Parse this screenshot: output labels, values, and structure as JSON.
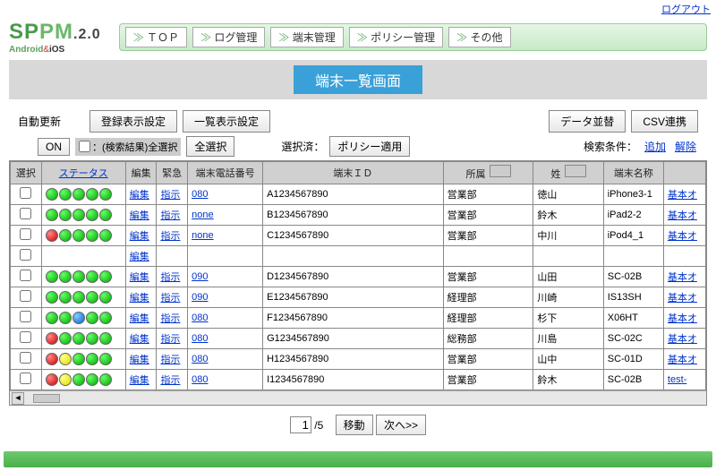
{
  "links": {
    "logout": "ログアウト"
  },
  "logo": {
    "brand": "SPPM",
    "version": ".2.0",
    "sub_android": "Android",
    "sub_amp": "&",
    "sub_ios": "iOS"
  },
  "nav": [
    "ＴＯＰ",
    "ログ管理",
    "端末管理",
    "ポリシー管理",
    "その他"
  ],
  "page_title": "端末一覧画面",
  "toolbar": {
    "auto_refresh_label": "自動更新",
    "on_btn": "ON",
    "reg_display_btn": "登録表示設定",
    "list_display_btn": "一覧表示設定",
    "data_sort_btn": "データ並替",
    "csv_btn": "CSV連携",
    "search_all_chk": "：(検索結果)全選択",
    "select_all_btn": "全選択",
    "selected_label": "選択済：",
    "policy_apply_btn": "ポリシー適用",
    "cond_label": "検索条件：",
    "cond_add": "追加",
    "cond_remove": "解除"
  },
  "headers": {
    "select": "選択",
    "status": "ステータス",
    "edit": "編集",
    "urgent": "緊急",
    "phone": "端末電話番号",
    "id": "端末ＩＤ",
    "dept": "所属",
    "name": "姓",
    "device": "端末名称",
    "basic": ""
  },
  "rows": [
    {
      "status": [
        "g",
        "g",
        "g",
        "g",
        "g"
      ],
      "edit": "編集",
      "urgent": "指示",
      "phone": "080",
      "id": "A1234567890",
      "dept": "営業部",
      "name": "徳山",
      "device": "iPhone3-1",
      "basic": "基本オ"
    },
    {
      "status": [
        "g",
        "g",
        "g",
        "g",
        "g"
      ],
      "edit": "編集",
      "urgent": "指示",
      "phone": "none",
      "id": "B1234567890",
      "dept": "営業部",
      "name": "鈴木",
      "device": "iPad2-2",
      "basic": "基本オ"
    },
    {
      "status": [
        "r",
        "g",
        "g",
        "g",
        "g"
      ],
      "edit": "編集",
      "urgent": "指示",
      "phone": "none",
      "id": "C1234567890",
      "dept": "営業部",
      "name": "中川",
      "device": "iPod4_1",
      "basic": "基本オ"
    },
    {
      "status": [],
      "edit": "編集",
      "urgent": "",
      "phone": "",
      "id": "",
      "dept": "",
      "name": "",
      "device": "",
      "basic": ""
    },
    {
      "status": [
        "g",
        "g",
        "g",
        "g",
        "g"
      ],
      "edit": "編集",
      "urgent": "指示",
      "phone": "090",
      "id": "D1234567890",
      "dept": "営業部",
      "name": "山田",
      "device": "SC-02B",
      "basic": "基本オ"
    },
    {
      "status": [
        "g",
        "g",
        "g",
        "g",
        "g"
      ],
      "edit": "編集",
      "urgent": "指示",
      "phone": "090",
      "id": "E1234567890",
      "dept": "経理部",
      "name": "川崎",
      "device": "IS13SH",
      "basic": "基本オ"
    },
    {
      "status": [
        "g",
        "g",
        "b",
        "g",
        "g"
      ],
      "edit": "編集",
      "urgent": "指示",
      "phone": "080",
      "id": "F1234567890",
      "dept": "経理部",
      "name": "杉下",
      "device": "X06HT",
      "basic": "基本オ"
    },
    {
      "status": [
        "r",
        "g",
        "g",
        "g",
        "g"
      ],
      "edit": "編集",
      "urgent": "指示",
      "phone": "080",
      "id": "G1234567890",
      "dept": "総務部",
      "name": "川島",
      "device": "SC-02C",
      "basic": "基本オ"
    },
    {
      "status": [
        "r",
        "y",
        "g",
        "g",
        "g"
      ],
      "edit": "編集",
      "urgent": "指示",
      "phone": "080",
      "id": "H1234567890",
      "dept": "営業部",
      "name": "山中",
      "device": "SC-01D",
      "basic": "基本オ"
    },
    {
      "status": [
        "r",
        "y",
        "g",
        "g",
        "g"
      ],
      "edit": "編集",
      "urgent": "指示",
      "phone": "080",
      "id": "I1234567890",
      "dept": "営業部",
      "name": "鈴木",
      "device": "SC-02B",
      "basic": "test-"
    }
  ],
  "pager": {
    "current": "1",
    "total": "/5",
    "move": "移動",
    "next": "次へ>>"
  }
}
